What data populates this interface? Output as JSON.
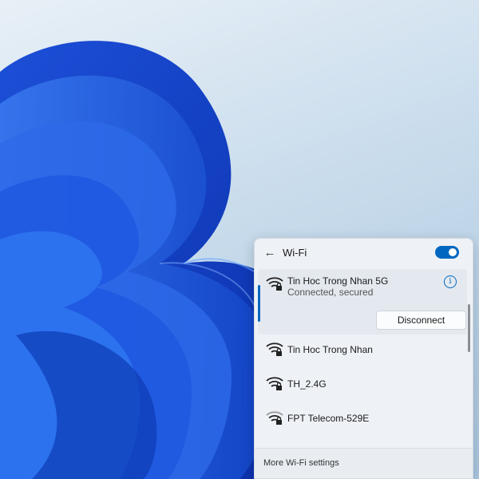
{
  "wifi_panel": {
    "title": "Wi-Fi",
    "toggle_state": "on",
    "accent_color": "#0067c0",
    "back_icon": "back-arrow-icon",
    "connected": {
      "name": "Tin Hoc Trong Nhan 5G",
      "status": "Connected, secured",
      "disconnect_label": "Disconnect",
      "info_icon": "info-icon",
      "info_glyph": "i"
    },
    "networks": [
      {
        "name": "Tin Hoc Trong Nhan",
        "icon": "wifi-secured-icon"
      },
      {
        "name": "TH_2.4G",
        "icon": "wifi-secured-icon"
      },
      {
        "name": "FPT Telecom-529E",
        "icon": "wifi-secured-icon"
      }
    ],
    "more_settings": "More Wi-Fi settings"
  }
}
